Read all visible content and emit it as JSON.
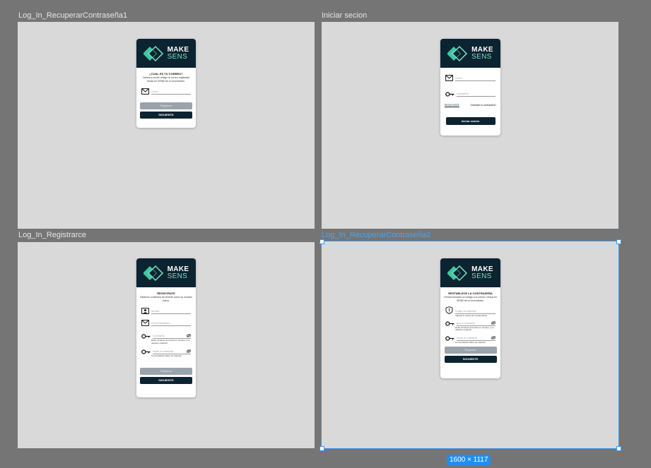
{
  "frames": {
    "recover1": {
      "label": "Log_In_RecuperarContraseña1"
    },
    "login": {
      "label": "Iniciar secion"
    },
    "register": {
      "label": "Log_In_Registrarce"
    },
    "recover2": {
      "label": "Log_In_RecuperarContraseña2"
    }
  },
  "selection_size": "1600 × 1117",
  "logo": {
    "make": "MAKE",
    "sens": "SENS"
  },
  "colors": {
    "canvas": "#757575",
    "frame": "#d9d9d9",
    "brand_dark": "#0c2331",
    "brand_accent": "#7ee0c2",
    "selection": "#3a96ef"
  },
  "recover1": {
    "title": "¿CUAL ES TU CORREO?",
    "subtitle": "Vamos a enviar código al correo registrado revisa en SPAM de no encontrarlo.",
    "email_placeholder": "Correo",
    "register_label": "Registrar",
    "next_label": "SIGUIENTE"
  },
  "login": {
    "email_placeholder": "Correo",
    "password_placeholder": "Contraseña",
    "register_link": "REGISTRATE",
    "forgot_link": "Olvidaste tu contraseña?",
    "submit_label": "Iniciar sesión"
  },
  "register": {
    "title": "REGISTRATE",
    "subtitle": "Estamos contentos de tenerte como un usuario nuevo.",
    "name_placeholder": "Nombre",
    "email_placeholder": "Correo Electrónico",
    "password_placeholder": "Contraseña",
    "password_helper": "Debe contener al menos un numero y un carácter especial",
    "repeat_placeholder": "Repite la contraseña",
    "repeat_helper": "La contraseña debe ser idéntica",
    "register_label": "Registrar",
    "next_label": "SIGUIENTE"
  },
  "recover2": {
    "title": "RESTABLECE LA CONTRASEÑA",
    "subtitle": "Hemos enviado un código a tu correo, revisa en SPAM de no encontrarlo.",
    "code_placeholder": "Código de seguridad",
    "code_helper": "Ingresa tu correo de recuperación",
    "new_password_placeholder": "Nueva contraseña",
    "new_password_helper": "Debe contener al menos un numero y un carácter especial",
    "repeat_placeholder": "Repite la contraseña",
    "repeat_helper": "La contraseña debe ser idéntica",
    "register_label": "Registrar",
    "next_label": "SIGUIENTE"
  }
}
